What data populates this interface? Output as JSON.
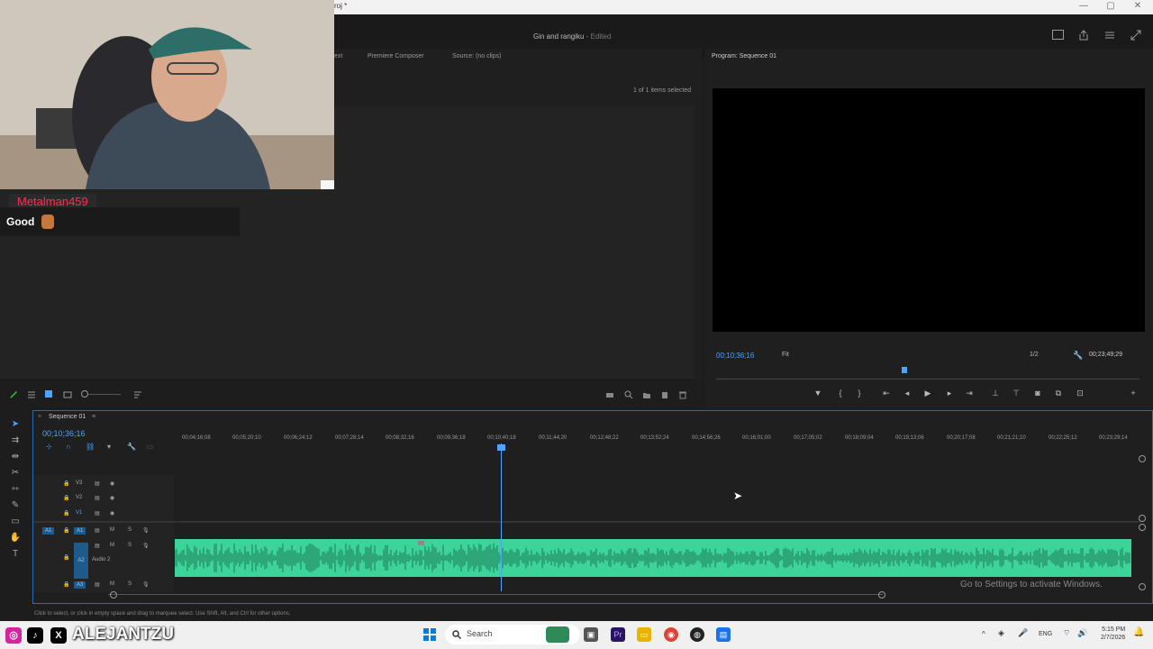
{
  "window": {
    "title_fragment": "roj *",
    "controls": [
      "—",
      "▢",
      "✕"
    ]
  },
  "header": {
    "project": "Gin and rangiku",
    "project_state": "- Edited"
  },
  "source_panel": {
    "tabs": [
      "ext",
      "Premiere Composer",
      "Source: (no clips)"
    ],
    "items_selected": "1 of 1 items selected"
  },
  "program_monitor": {
    "title": "Program: Sequence 01",
    "timecode": "00;10;36;16",
    "fit": "Fit",
    "resolution": "1/2",
    "duration": "00;23;49;29",
    "playhead_fraction": 0.445
  },
  "timeline": {
    "sequence_name": "Sequence 01",
    "timecode": "00;10;36;16",
    "ruler_ticks": [
      "00;04;16;08",
      "00;05;20;10",
      "00;06;24;12",
      "00;07;28;14",
      "00;08;32;16",
      "00;09;36;18",
      "00;10;40;18",
      "00;11;44;20",
      "00;12;48;22",
      "00;13;52;24",
      "00;14;56;26",
      "00;16;01;00",
      "00;17;05;02",
      "00;18;09;04",
      "00;19;13;06",
      "00;20;17;08",
      "00;21;21;10",
      "00;22;25;12",
      "00;23;29;14"
    ],
    "video_tracks": [
      "V3",
      "V2",
      "V1"
    ],
    "audio_tracks": [
      "A1",
      "A2",
      "A3"
    ],
    "audio2_name": "Audio 2",
    "watermark": "Go to Settings to activate Windows."
  },
  "status_bar": {
    "hint": "Click to select, or click in empty space and drag to marquee select. Use Shift, Alt, and Ctrl for other options."
  },
  "stream_overlay": {
    "chat_user": "Metalman459",
    "chat_message": "Good",
    "social_handle": "ALEJANTZU"
  },
  "taskbar": {
    "search_placeholder": "Search",
    "language": "ENG",
    "time": "5:15 PM",
    "date": "2/7/2026"
  },
  "colors": {
    "accent_blue": "#4da3ff",
    "audio_clip": "#3dd49a",
    "chat_name": "#ff2d55"
  }
}
